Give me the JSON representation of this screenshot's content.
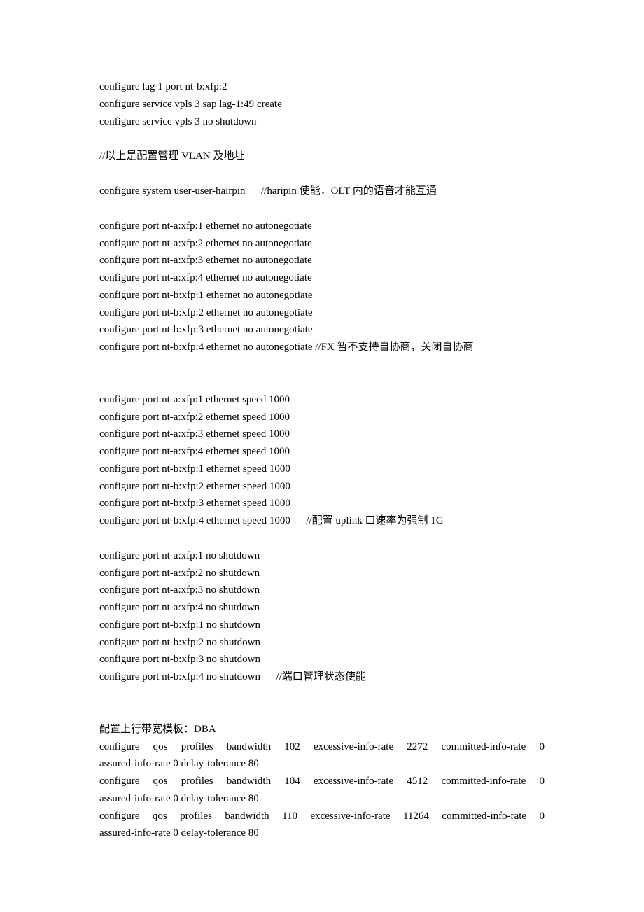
{
  "lines": [
    {
      "type": "text",
      "text": "configure lag 1 port nt-b:xfp:2"
    },
    {
      "type": "text",
      "text": "configure service vpls 3 sap lag-1:49 create"
    },
    {
      "type": "text",
      "text": "configure service vpls 3 no shutdown"
    },
    {
      "type": "blank"
    },
    {
      "type": "text",
      "text": "//以上是配置管理 VLAN 及地址"
    },
    {
      "type": "blank"
    },
    {
      "type": "text",
      "text": "configure system user-user-hairpin      //haripin 使能，OLT 内的语音才能互通"
    },
    {
      "type": "blank"
    },
    {
      "type": "text",
      "text": "configure port nt-a:xfp:1 ethernet no autonegotiate"
    },
    {
      "type": "text",
      "text": "configure port nt-a:xfp:2 ethernet no autonegotiate"
    },
    {
      "type": "text",
      "text": "configure port nt-a:xfp:3 ethernet no autonegotiate"
    },
    {
      "type": "text",
      "text": "configure port nt-a:xfp:4 ethernet no autonegotiate"
    },
    {
      "type": "text",
      "text": "configure port nt-b:xfp:1 ethernet no autonegotiate"
    },
    {
      "type": "text",
      "text": "configure port nt-b:xfp:2 ethernet no autonegotiate"
    },
    {
      "type": "text",
      "text": "configure port nt-b:xfp:3 ethernet no autonegotiate"
    },
    {
      "type": "text",
      "text": "configure port nt-b:xfp:4 ethernet no autonegotiate //FX 暂不支持自协商，关闭自协商"
    },
    {
      "type": "blank"
    },
    {
      "type": "blank"
    },
    {
      "type": "text",
      "text": "configure port nt-a:xfp:1 ethernet speed 1000"
    },
    {
      "type": "text",
      "text": "configure port nt-a:xfp:2 ethernet speed 1000"
    },
    {
      "type": "text",
      "text": "configure port nt-a:xfp:3 ethernet speed 1000"
    },
    {
      "type": "text",
      "text": "configure port nt-a:xfp:4 ethernet speed 1000"
    },
    {
      "type": "text",
      "text": "configure port nt-b:xfp:1 ethernet speed 1000"
    },
    {
      "type": "text",
      "text": "configure port nt-b:xfp:2 ethernet speed 1000"
    },
    {
      "type": "text",
      "text": "configure port nt-b:xfp:3 ethernet speed 1000"
    },
    {
      "type": "text",
      "text": "configure port nt-b:xfp:4 ethernet speed 1000      //配置 uplink 口速率为强制 1G"
    },
    {
      "type": "blank"
    },
    {
      "type": "text",
      "text": "configure port nt-a:xfp:1 no shutdown"
    },
    {
      "type": "text",
      "text": "configure port nt-a:xfp:2 no shutdown"
    },
    {
      "type": "text",
      "text": "configure port nt-a:xfp:3 no shutdown"
    },
    {
      "type": "text",
      "text": "configure port nt-a:xfp:4 no shutdown"
    },
    {
      "type": "text",
      "text": "configure port nt-b:xfp:1 no shutdown"
    },
    {
      "type": "text",
      "text": "configure port nt-b:xfp:2 no shutdown"
    },
    {
      "type": "text",
      "text": "configure port nt-b:xfp:3 no shutdown"
    },
    {
      "type": "text",
      "text": "configure port nt-b:xfp:4 no shutdown      //端口管理状态使能"
    },
    {
      "type": "blank"
    },
    {
      "type": "blank"
    },
    {
      "type": "text",
      "text": "配置上行带宽模板：DBA"
    },
    {
      "type": "justify",
      "text": "configure qos profiles bandwidth 102 excessive-info-rate 2272 committed-info-rate 0"
    },
    {
      "type": "text",
      "text": "assured-info-rate 0 delay-tolerance 80"
    },
    {
      "type": "justify",
      "text": "configure qos profiles bandwidth 104 excessive-info-rate 4512 committed-info-rate 0"
    },
    {
      "type": "text",
      "text": "assured-info-rate 0 delay-tolerance 80"
    },
    {
      "type": "justify",
      "text": "configure qos profiles bandwidth 110 excessive-info-rate 11264 committed-info-rate 0"
    },
    {
      "type": "text",
      "text": "assured-info-rate 0 delay-tolerance 80"
    }
  ]
}
